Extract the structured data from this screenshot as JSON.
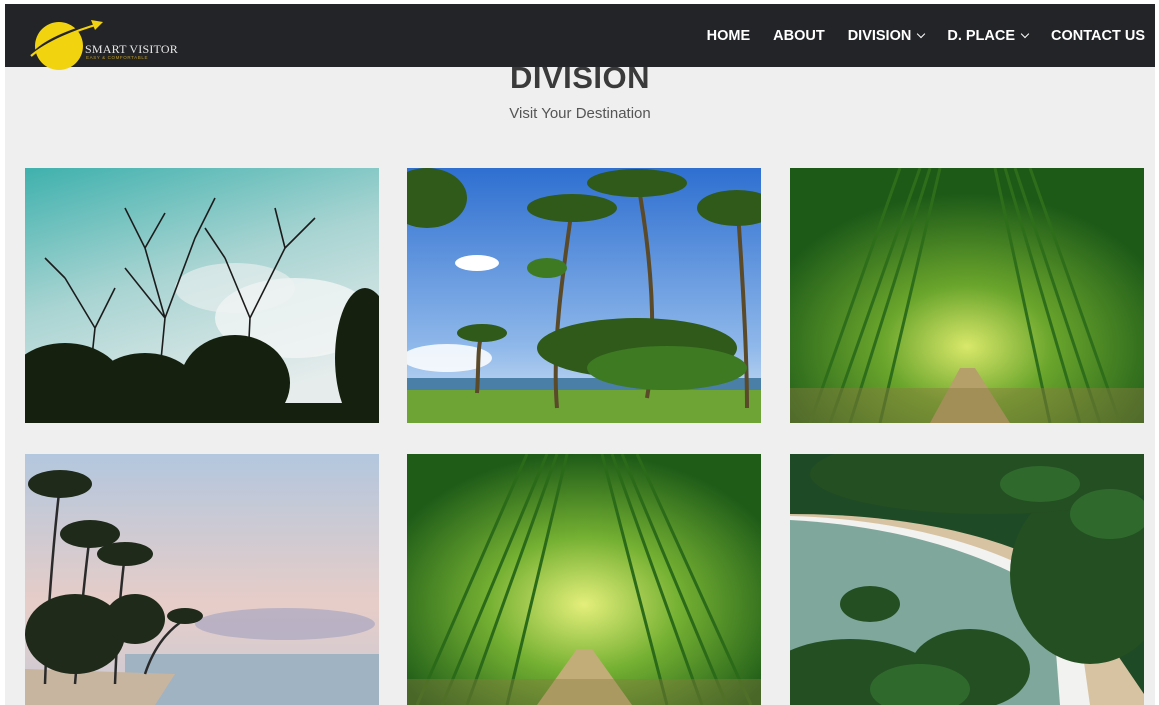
{
  "brand": {
    "name": "SMART VISITOR",
    "tagline": "EASY & COMFORTABLE",
    "accent": "#f2d30f"
  },
  "nav": {
    "items": [
      {
        "label": "HOME",
        "has_dropdown": false
      },
      {
        "label": "ABOUT",
        "has_dropdown": false
      },
      {
        "label": "DIVISION",
        "has_dropdown": true
      },
      {
        "label": "D. PLACE",
        "has_dropdown": true
      },
      {
        "label": "CONTACT US",
        "has_dropdown": false
      }
    ]
  },
  "section": {
    "title": "DIVISION",
    "subtitle": "Visit Your Destination"
  },
  "gallery": [
    {
      "scene": "bare trees under teal sky"
    },
    {
      "scene": "palm trees on beach"
    },
    {
      "scene": "bamboo tunnel path"
    },
    {
      "scene": "palm trees at sunset beach"
    },
    {
      "scene": "bamboo tunnel path"
    },
    {
      "scene": "tropical cove with sandy beach"
    }
  ],
  "colors": {
    "navbar": "#232427",
    "background": "#efefef",
    "heading": "#3a3a3a"
  }
}
